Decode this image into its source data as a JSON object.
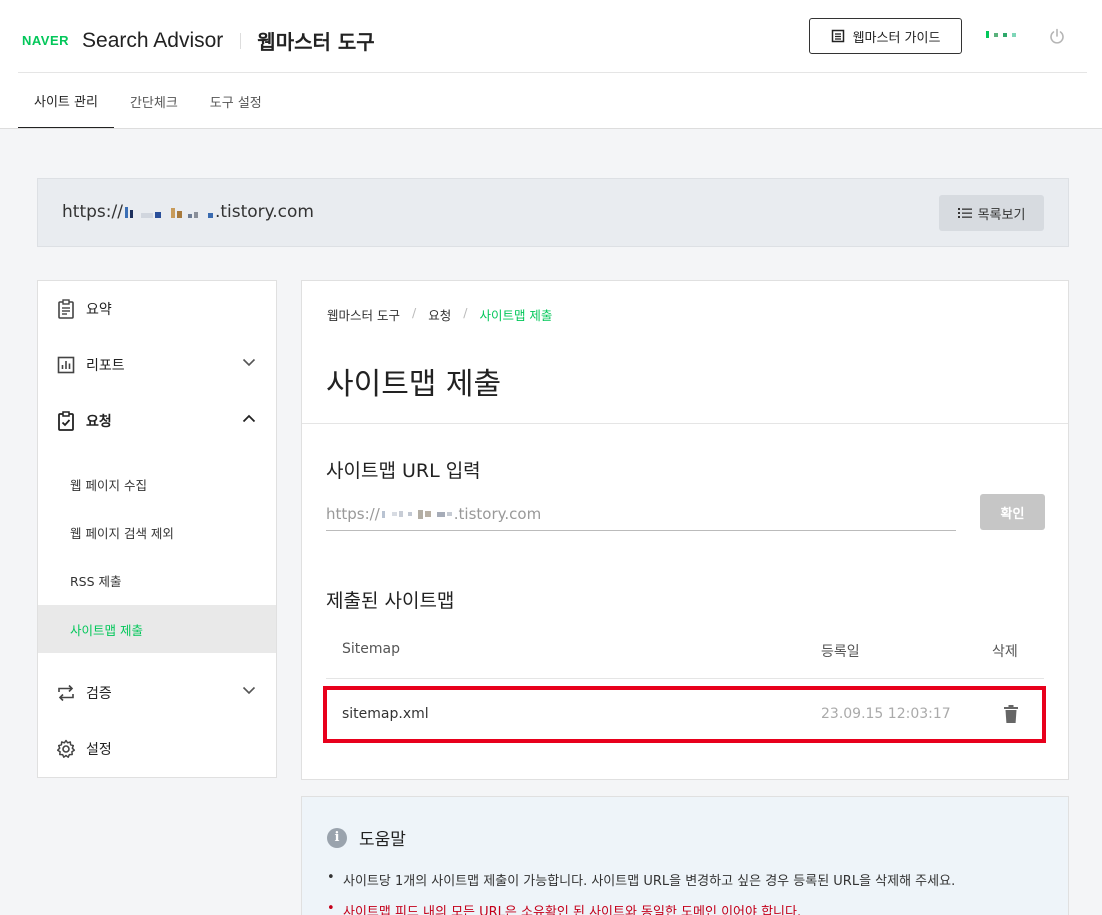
{
  "header": {
    "brand": "NAVER",
    "product": "Search Advisor",
    "tool_title": "웹마스터 도구",
    "guide_button": "웹마스터 가이드",
    "tabs": [
      {
        "label": "사이트 관리",
        "active": true
      },
      {
        "label": "간단체크",
        "active": false
      },
      {
        "label": "도구 설정",
        "active": false
      }
    ]
  },
  "site": {
    "url_prefix": "https://",
    "url_suffix": ".tistory.com",
    "list_button": "목록보기"
  },
  "sidebar": {
    "items": [
      {
        "label": "요약",
        "icon": "clipboard-icon"
      },
      {
        "label": "리포트",
        "icon": "chart-icon",
        "expanded": false
      },
      {
        "label": "요청",
        "icon": "clipboard-check-icon",
        "expanded": true
      },
      {
        "label": "검증",
        "icon": "repeat-icon",
        "expanded": false
      },
      {
        "label": "설정",
        "icon": "gear-icon"
      }
    ],
    "sub_items": [
      {
        "label": "웹 페이지 수집",
        "active": false
      },
      {
        "label": "웹 페이지 검색 제외",
        "active": false
      },
      {
        "label": "RSS 제출",
        "active": false
      },
      {
        "label": "사이트맵 제출",
        "active": true
      }
    ]
  },
  "main": {
    "breadcrumb": [
      "웹마스터 도구",
      "요청",
      "사이트맵 제출"
    ],
    "title": "사이트맵 제출",
    "input_section_title": "사이트맵 URL 입력",
    "input_prefix": "https://",
    "input_suffix": ".tistory.com",
    "confirm_button": "확인",
    "submitted_title": "제출된 사이트맵",
    "table": {
      "headers": [
        "Sitemap",
        "등록일",
        "삭제"
      ],
      "rows": [
        {
          "sitemap": "sitemap.xml",
          "date": "23.09.15 12:03:17"
        }
      ]
    }
  },
  "help": {
    "title": "도움말",
    "lines": [
      "사이트당 1개의 사이트맵 제출이 가능합니다. 사이트맵 URL을 변경하고 싶은 경우 등록된 URL을 삭제해 주세요.",
      "사이트맵 피드 내의 모든 URL은 소유확인 된 사이트와 동일한 도메인 이어야 합니다."
    ]
  },
  "colors": {
    "brand_green": "#03c75a",
    "highlight_red": "#e8001c",
    "help_warning": "#c4001a"
  }
}
